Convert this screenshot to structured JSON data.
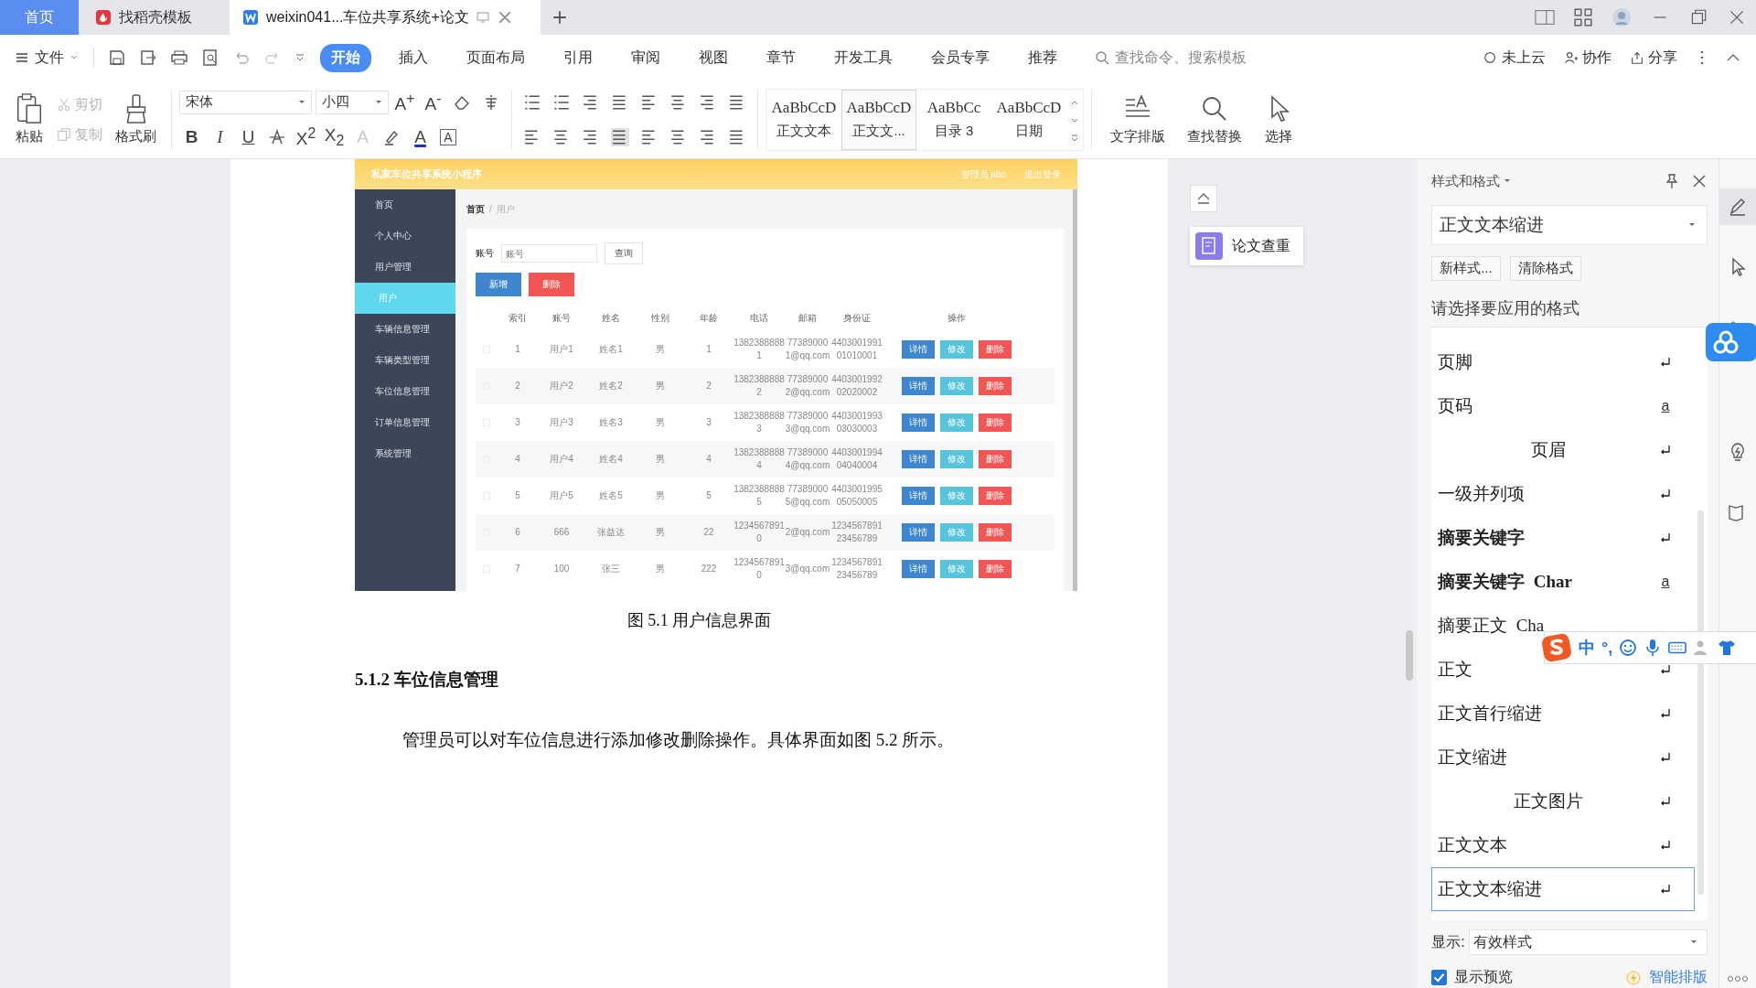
{
  "browser_tabs": [
    {
      "label": "首页",
      "kind": "home",
      "selected": false
    },
    {
      "label": "找稻壳模板",
      "kind": "template",
      "selected": false
    },
    {
      "label": "weixin041...车位共享系统+论文",
      "kind": "document",
      "selected": true
    }
  ],
  "menu": {
    "file": "文件",
    "tabs": [
      {
        "label": "开始",
        "selected": true
      },
      {
        "label": "插入",
        "selected": false
      },
      {
        "label": "页面布局",
        "selected": false
      },
      {
        "label": "引用",
        "selected": false
      },
      {
        "label": "审阅",
        "selected": false
      },
      {
        "label": "视图",
        "selected": false
      },
      {
        "label": "章节",
        "selected": false
      },
      {
        "label": "开发工具",
        "selected": false
      },
      {
        "label": "会员专享",
        "selected": false
      },
      {
        "label": "推荐",
        "selected": false
      }
    ],
    "search": {
      "placeholder": "查找命令、搜索模板"
    },
    "actions": [
      "未上云",
      "协作",
      "分享"
    ]
  },
  "ribbon": {
    "paste": "粘贴",
    "cut": {
      "label": "剪切",
      "disabled": true
    },
    "copy": {
      "label": "复制",
      "disabled": true
    },
    "painter": "格式刷",
    "font": {
      "name": "宋体",
      "size": "小四"
    },
    "size_buttons": [
      "A$^{+}$",
      "A$^{-}$"
    ],
    "format_buttons": [
      {
        "label": "B",
        "kind": "bold"
      },
      {
        "label": "I",
        "kind": "italic"
      },
      {
        "label": "U",
        "kind": "underline"
      },
      {
        "label": "X$^{2}$",
        "kind": "plain"
      },
      {
        "label": "X$_{2}$",
        "kind": "plain"
      },
      {
        "label": "A",
        "kind": "faded"
      },
      {
        "label": "A",
        "kind": "color"
      },
      {
        "label": "A",
        "kind": "boxed"
      }
    ],
    "styles": [
      {
        "sample": "AaBbCcD",
        "name": "正文文本",
        "selected": false
      },
      {
        "sample": "AaBbCcD",
        "name": "正文文...",
        "selected": true
      },
      {
        "sample": "AaBbCc",
        "name": "目录 3",
        "selected": false
      },
      {
        "sample": "AaBbCcD",
        "name": "日期",
        "selected": false
      }
    ],
    "tools": [
      {
        "label": "文字排版",
        "kind": "layout"
      },
      {
        "label": "查找替换",
        "kind": "find"
      },
      {
        "label": "选择",
        "kind": "select"
      }
    ]
  },
  "document": {
    "figure": {
      "title": "私家车位共享系统小程序",
      "user": "管理员 abo",
      "logout": "退出登录",
      "nav": [
        {
          "label": "首页",
          "selected": false
        },
        {
          "label": "个人中心",
          "selected": false
        },
        {
          "label": "用户管理",
          "selected": false
        },
        {
          "label": "用户",
          "selected": true
        },
        {
          "label": "车辆信息管理",
          "selected": false
        },
        {
          "label": "车辆类型管理",
          "selected": false
        },
        {
          "label": "车位信息管理",
          "selected": false
        },
        {
          "label": "订单信息管理",
          "selected": false
        },
        {
          "label": "系统管理",
          "selected": false
        }
      ],
      "breadcrumb": [
        "首页",
        "/",
        "用户"
      ],
      "search_label": "账号",
      "search_placeholder": "账号",
      "search_button": "查询",
      "add_button": "新增",
      "delete_button": "删除",
      "columns": [
        "索引",
        "账号",
        "姓名",
        "性别",
        "年龄",
        "电话",
        "邮箱",
        "身份证",
        "操作"
      ],
      "rows": [
        {
          "checked": false,
          "cells": [
            "1",
            "用户1",
            "姓名1",
            "男",
            "1",
            "13823888881",
            "773890001@qq.com",
            "440300199101010001"
          ],
          "actions": [
            "详情",
            "修改",
            "删除"
          ]
        },
        {
          "checked": false,
          "cells": [
            "2",
            "用户2",
            "姓名2",
            "男",
            "2",
            "13823888882",
            "773890002@qq.com",
            "440300199202020002"
          ],
          "actions": [
            "详情",
            "修改",
            "删除"
          ]
        },
        {
          "checked": false,
          "cells": [
            "3",
            "用户3",
            "姓名3",
            "男",
            "3",
            "13823888883",
            "773890003@qq.com",
            "440300199303030003"
          ],
          "actions": [
            "详情",
            "修改",
            "删除"
          ]
        },
        {
          "checked": false,
          "cells": [
            "4",
            "用户4",
            "姓名4",
            "男",
            "4",
            "13823888884",
            "773890004@qq.com",
            "440300199404040004"
          ],
          "actions": [
            "详情",
            "修改",
            "删除"
          ]
        },
        {
          "checked": false,
          "cells": [
            "5",
            "用户5",
            "姓名5",
            "男",
            "5",
            "13823888885",
            "773890005@qq.com",
            "440300199505050005"
          ],
          "actions": [
            "详情",
            "修改",
            "删除"
          ]
        },
        {
          "checked": false,
          "cells": [
            "6",
            "666",
            "张益达",
            "男",
            "22",
            "12345678910",
            "2@qq.com",
            "123456789123456789"
          ],
          "actions": [
            "详情",
            "修改",
            "删除"
          ]
        },
        {
          "checked": false,
          "cells": [
            "7",
            "100",
            "张三",
            "男",
            "222",
            "12345678910",
            "3@qq.com",
            "123456789123456789"
          ],
          "actions": [
            "详情",
            "修改",
            "删除"
          ]
        }
      ],
      "caption": "图 5.1 用户信息界面"
    },
    "heading": "5.1.2  车位信息管理",
    "paragraph": "管理员可以对车位信息进行添加修改删除操作。具体界面如图 5.2 所示。"
  },
  "check_button": "论文查重",
  "styles_panel": {
    "title": "样式和格式",
    "current": "正文文本缩进",
    "buttons": [
      "新样式...",
      "清除格式"
    ],
    "prompt": "请选择要应用的格式",
    "items": [
      {
        "name": "页脚",
        "kind": "para",
        "bold": false,
        "centered": false,
        "selected": false
      },
      {
        "name": "页码",
        "kind": "char",
        "mark": "a",
        "bold": false,
        "centered": false,
        "selected": false
      },
      {
        "name": "页眉",
        "kind": "para",
        "bold": false,
        "centered": true,
        "selected": false
      },
      {
        "name": "一级并列项",
        "kind": "para",
        "bold": false,
        "centered": false,
        "selected": false
      },
      {
        "name": "摘要关键字",
        "kind": "para",
        "bold": true,
        "centered": false,
        "selected": false
      },
      {
        "name": "摘要关键字  Char",
        "kind": "char",
        "mark": "a",
        "bold": true,
        "centered": false,
        "selected": false
      },
      {
        "name": "摘要正文  Cha",
        "kind": "char",
        "bold": false,
        "centered": false,
        "selected": false
      },
      {
        "name": "正文",
        "kind": "para",
        "bold": false,
        "centered": false,
        "selected": false
      },
      {
        "name": "正文首行缩进",
        "kind": "para",
        "bold": false,
        "centered": false,
        "selected": false
      },
      {
        "name": "正文缩进",
        "kind": "para",
        "bold": false,
        "centered": false,
        "selected": false
      },
      {
        "name": "正文图片",
        "kind": "para",
        "bold": false,
        "centered": true,
        "selected": false
      },
      {
        "name": "正文文本",
        "kind": "para",
        "bold": false,
        "centered": false,
        "selected": false
      },
      {
        "name": "正文文本缩进",
        "kind": "para",
        "bold": false,
        "centered": false,
        "selected": true
      }
    ],
    "show_label": "显示:",
    "show_value": "有效样式",
    "preview": {
      "label": "显示预览",
      "checked": true
    },
    "smart": "智能排版"
  },
  "ime": {
    "mode": "中",
    "punct": "°,"
  }
}
